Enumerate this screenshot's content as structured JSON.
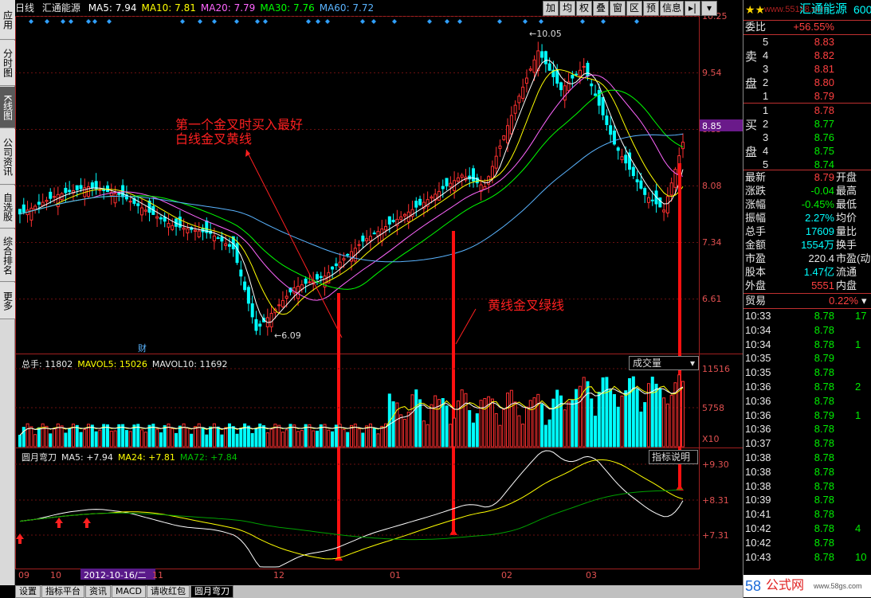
{
  "app": {
    "title_period": "日线",
    "stock_name": "汇通能源",
    "ma_labels": [
      {
        "text": "MA5: 7.94",
        "color": "#ffffff"
      },
      {
        "text": "MA10: 7.81",
        "color": "#ffff00"
      },
      {
        "text": "MA20: 7.79",
        "color": "#ff66ff"
      },
      {
        "text": "MA30: 7.76",
        "color": "#00ff00"
      },
      {
        "text": "MA60: 7.72",
        "color": "#5ab4ff"
      }
    ],
    "toolbar": [
      "加",
      "均",
      "权",
      "叠",
      "窗",
      "区",
      "预",
      "信息",
      "▸|",
      "▾"
    ]
  },
  "sidebar": [
    {
      "label": "应用",
      "active": false
    },
    {
      "label": "分时图",
      "active": false
    },
    {
      "label": "K线图",
      "active": true
    },
    {
      "label": "公司资讯",
      "active": false
    },
    {
      "label": "自选股",
      "active": false
    },
    {
      "label": "综合排名",
      "active": false
    },
    {
      "label": "更多",
      "active": false
    }
  ],
  "price_axis": [
    "10.25",
    "9.54",
    "8.85",
    "8.08",
    "7.34",
    "6.61"
  ],
  "current_price_tag": "8.85",
  "annotations": {
    "high": "10.05",
    "low": "6.09",
    "cai": "财",
    "note1_line1": "第一个金叉时买入最好",
    "note1_line2": "白线金叉黄线",
    "note2": "黄线金叉绿线"
  },
  "volume_panel": {
    "labels": [
      {
        "text": "总手: 11802",
        "color": "#e8e8e8"
      },
      {
        "text": "MAVOL5: 15026",
        "color": "#ffff00"
      },
      {
        "text": "MAVOL10: 11692",
        "color": "#e8e8e8"
      }
    ],
    "dropdown": "成交量",
    "axis": [
      "11516",
      "5758",
      "X10"
    ]
  },
  "indicator_panel": {
    "labels": [
      {
        "text": "圆月弯刀",
        "color": "#e8e8e8"
      },
      {
        "text": "MA5: +7.94",
        "color": "#e8e8e8"
      },
      {
        "text": "MA24: +7.81",
        "color": "#ffff00"
      },
      {
        "text": "MA72: +7.84",
        "color": "#00c000"
      }
    ],
    "button": "指标说明",
    "axis": [
      "+9.30",
      "+8.31",
      "+7.31"
    ]
  },
  "date_axis": [
    {
      "text": "09",
      "highlight": false
    },
    {
      "text": "10",
      "highlight": false
    },
    {
      "text": "2012-10-16/二",
      "highlight": true
    },
    {
      "text": "11",
      "highlight": false
    },
    {
      "text": "12",
      "highlight": false
    },
    {
      "text": "01",
      "highlight": false
    },
    {
      "text": "02",
      "highlight": false
    },
    {
      "text": "03",
      "highlight": false
    }
  ],
  "bottom_tabs": [
    {
      "label": "设置",
      "active": false
    },
    {
      "label": "指标平台",
      "active": false
    },
    {
      "label": "资讯",
      "active": false
    },
    {
      "label": "MACD",
      "active": false
    },
    {
      "label": "请收红包",
      "active": false
    },
    {
      "label": "圆月弯刀",
      "active": true
    }
  ],
  "quote": {
    "header_name": "汇通能源",
    "header_code": "600",
    "watermark": "www.55188.com",
    "weibi_label": "委比",
    "weibi_value": "+56.55%",
    "sell_label_top": "卖",
    "sell_label_bot": "盘",
    "buy_label_top": "买",
    "buy_label_bot": "盘",
    "sell": [
      {
        "lvl": "5",
        "price": "8.83"
      },
      {
        "lvl": "4",
        "price": "8.82"
      },
      {
        "lvl": "3",
        "price": "8.81"
      },
      {
        "lvl": "2",
        "price": "8.80"
      },
      {
        "lvl": "1",
        "price": "8.79"
      }
    ],
    "buy": [
      {
        "lvl": "1",
        "price": "8.78"
      },
      {
        "lvl": "2",
        "price": "8.77"
      },
      {
        "lvl": "3",
        "price": "8.76"
      },
      {
        "lvl": "4",
        "price": "8.75"
      },
      {
        "lvl": "5",
        "price": "8.74"
      }
    ],
    "stats": [
      {
        "k": "最新",
        "v": "8.79",
        "vc": "#ff4040",
        "k2": "开盘"
      },
      {
        "k": "涨跌",
        "v": "-0.04",
        "vc": "#00ee00",
        "k2": "最高"
      },
      {
        "k": "涨幅",
        "v": "-0.45%",
        "vc": "#00ee00",
        "k2": "最低"
      },
      {
        "k": "振幅",
        "v": "2.27%",
        "vc": "#00ffff",
        "k2": "均价"
      },
      {
        "k": "总手",
        "v": "17609",
        "vc": "#00ffff",
        "k2": "量比"
      },
      {
        "k": "金额",
        "v": "1554万",
        "vc": "#00ffff",
        "k2": "换手"
      },
      {
        "k": "市盈",
        "v": "220.4",
        "vc": "#e8e8e8",
        "k2": "市盈(动"
      },
      {
        "k": "股本",
        "v": "1.47亿",
        "vc": "#00ffff",
        "k2": "流通"
      },
      {
        "k": "外盘",
        "v": "5551",
        "vc": "#ff4040",
        "k2": "内盘"
      }
    ],
    "trade_label": "贸易",
    "trade_pct": "0.22%",
    "ticks": [
      {
        "t": "10:33",
        "p": "8.78",
        "v": "17"
      },
      {
        "t": "10:34",
        "p": "8.78",
        "v": ""
      },
      {
        "t": "10:34",
        "p": "8.78",
        "v": "1"
      },
      {
        "t": "10:35",
        "p": "8.79",
        "v": ""
      },
      {
        "t": "10:35",
        "p": "8.78",
        "v": ""
      },
      {
        "t": "10:36",
        "p": "8.78",
        "v": "2"
      },
      {
        "t": "10:36",
        "p": "8.78",
        "v": ""
      },
      {
        "t": "10:36",
        "p": "8.79",
        "v": "1"
      },
      {
        "t": "10:36",
        "p": "8.78",
        "v": ""
      },
      {
        "t": "10:37",
        "p": "8.78",
        "v": ""
      },
      {
        "t": "10:38",
        "p": "8.78",
        "v": ""
      },
      {
        "t": "10:38",
        "p": "8.78",
        "v": ""
      },
      {
        "t": "10:38",
        "p": "8.78",
        "v": ""
      },
      {
        "t": "10:39",
        "p": "8.78",
        "v": ""
      },
      {
        "t": "10:41",
        "p": "8.78",
        "v": ""
      },
      {
        "t": "10:42",
        "p": "8.78",
        "v": "4"
      },
      {
        "t": "10:42",
        "p": "8.78",
        "v": ""
      },
      {
        "t": "10:43",
        "p": "8.78",
        "v": "10"
      }
    ],
    "site_logo_num": "58",
    "site_logo_text": "公式网",
    "site_url": "www.58gs.com"
  },
  "colors": {
    "up": "#ff3030",
    "down": "#00ffff",
    "ma5": "#ffffff",
    "ma10": "#ffff00",
    "ma20": "#ff66ff",
    "ma30": "#00ff00",
    "ma60": "#5ab4ff"
  }
}
